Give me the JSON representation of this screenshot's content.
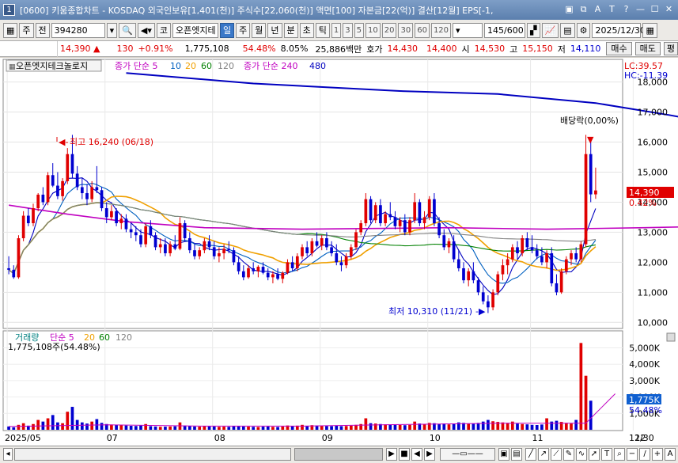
{
  "titlebar": {
    "window_num": "1",
    "text": "[0600] 키움종합차트 - KOSDAQ 외국인보유[1,401(천)] 주식수[22,060(천)] 액면[100] 자본금[22(억)] 결산[12월] EPS[-1,",
    "icons": [
      "window-icon",
      "restore-icon",
      "font-icon",
      "text-icon",
      "help-icon",
      "min-icon",
      "max-icon",
      "close-icon"
    ]
  },
  "toolbar": {
    "main_label": "주",
    "prev_label": "전",
    "code": "394280",
    "stock_name": "오픈엣지테",
    "periods": [
      "일",
      "주",
      "월",
      "년",
      "분",
      "초",
      "틱"
    ],
    "selected_period": "일",
    "intervals": [
      "1",
      "3",
      "5",
      "10",
      "20",
      "30",
      "60",
      "120"
    ],
    "count": "145/600",
    "date": "2025/12/30",
    "market_badge": "코"
  },
  "quote": {
    "price": "14,390",
    "change": "130",
    "change_pct": "+0.91%",
    "volume": "1,775,108",
    "vol_ratio": "54.48%",
    "turnover": "8.05%",
    "amount": "25,886백만",
    "hoga_label": "호가",
    "ask": "14,430",
    "bid": "14,400",
    "open_label": "시",
    "open": "14,530",
    "high_label": "고",
    "high": "15,150",
    "low_label": "저",
    "low": "14,110",
    "buy_label": "매수",
    "sell_label": "매도",
    "eval_label": "평"
  },
  "legend": {
    "stock_name": "오픈엣지테크놀로지",
    "price_ma": "종가 단순 5",
    "ma_periods": [
      "10",
      "20",
      "60",
      "120"
    ],
    "price_ma2": "종가 단순 240",
    "ma2_periods": [
      "480"
    ],
    "volume_title": "거래량",
    "volume_ma": "단순 5",
    "volume_ma_periods": [
      "20",
      "60",
      "120"
    ],
    "volume_value": "1,775,108주(54.48%)"
  },
  "annotations": {
    "high": "최고 16,240 (06/18)",
    "low": "최저 10,310 (11/21)",
    "dividend": "배당락(0,00%)",
    "lc": "LC:39.57",
    "hc": "HC:-11.39",
    "current_price_tag": "14,390",
    "current_pct_tag": "0.42%",
    "vol_tag": "1,775K",
    "vol_pct_tag": "54.48%"
  },
  "colors": {
    "up": "#e00000",
    "down": "#0000d0",
    "ma5": "#0000c0",
    "ma10": "#0060c0",
    "ma20": "#f0a000",
    "ma60": "#008000",
    "ma120": "#808080",
    "ma240": "#c000c0",
    "ma480": "#0000c0"
  },
  "chart_data": {
    "type": "candlestick",
    "price_axis_ticks": [
      "18,000",
      "17,000",
      "16,000",
      "15,000",
      "14,000",
      "13,000",
      "12,000",
      "11,000",
      "10,000"
    ],
    "price_axis_values": [
      18000,
      17000,
      16000,
      15000,
      14000,
      13000,
      12000,
      11000,
      10000
    ],
    "volume_axis_ticks": [
      "5,000K",
      "4,000K",
      "3,000K",
      "2,000K",
      "1,000K"
    ],
    "volume_axis_values": [
      5000,
      4000,
      3000,
      2000,
      1000
    ],
    "x_labels": [
      "2025/05",
      "07",
      "08",
      "09",
      "10",
      "11",
      "12",
      "12/30"
    ],
    "x_label_days": [
      0,
      20,
      42,
      64,
      86,
      107,
      128,
      145
    ],
    "ylim": [
      9850,
      18700
    ],
    "vol_ylim": [
      0,
      5800
    ],
    "ma240": [
      [
        0,
        13900
      ],
      [
        12,
        13600
      ],
      [
        24,
        13350
      ],
      [
        40,
        13150
      ],
      [
        60,
        13100
      ],
      [
        90,
        13150
      ],
      [
        110,
        13100
      ],
      [
        130,
        13150
      ],
      [
        145,
        13200
      ]
    ],
    "ma480": [
      [
        24,
        18300
      ],
      [
        50,
        17950
      ],
      [
        80,
        17700
      ],
      [
        100,
        17600
      ],
      [
        120,
        17300
      ],
      [
        135,
        16900
      ],
      [
        145,
        16600
      ]
    ],
    "candles": [
      [
        11800,
        12200,
        11600,
        11750
      ],
      [
        11750,
        11900,
        11450,
        11500
      ],
      [
        11500,
        12900,
        11450,
        12800
      ],
      [
        12800,
        13700,
        12700,
        13550
      ],
      [
        13550,
        13800,
        13200,
        13300
      ],
      [
        13300,
        13950,
        13200,
        13800
      ],
      [
        13800,
        14300,
        13700,
        14250
      ],
      [
        14250,
        14500,
        13900,
        14000
      ],
      [
        14000,
        15000,
        13900,
        14900
      ],
      [
        14900,
        15300,
        14500,
        14550
      ],
      [
        14550,
        15000,
        14100,
        14200
      ],
      [
        14200,
        14800,
        14050,
        14700
      ],
      [
        14700,
        15800,
        14600,
        15600
      ],
      [
        15600,
        16240,
        14800,
        14950
      ],
      [
        14950,
        15200,
        14400,
        14500
      ],
      [
        14500,
        14800,
        14100,
        14300
      ],
      [
        14300,
        14600,
        13900,
        14100
      ],
      [
        14100,
        14700,
        14000,
        14500
      ],
      [
        14500,
        15200,
        14300,
        14400
      ],
      [
        14400,
        14500,
        13700,
        13800
      ],
      [
        13800,
        14000,
        13300,
        13500
      ],
      [
        13500,
        13900,
        13400,
        13700
      ],
      [
        13700,
        13800,
        13200,
        13300
      ],
      [
        13300,
        13600,
        13100,
        13450
      ],
      [
        13450,
        13600,
        13000,
        13100
      ],
      [
        13100,
        13300,
        12800,
        13000
      ],
      [
        13000,
        13200,
        12700,
        12900
      ],
      [
        12900,
        13100,
        12500,
        12600
      ],
      [
        12600,
        13300,
        12500,
        13200
      ],
      [
        13200,
        13400,
        12800,
        12900
      ],
      [
        12900,
        13000,
        12400,
        12500
      ],
      [
        12500,
        12800,
        12300,
        12600
      ],
      [
        12600,
        12800,
        12200,
        12300
      ],
      [
        12300,
        12700,
        12200,
        12600
      ],
      [
        12600,
        12900,
        12400,
        12450
      ],
      [
        12450,
        13500,
        12400,
        13300
      ],
      [
        13300,
        13400,
        12700,
        12800
      ],
      [
        12800,
        13000,
        12300,
        12400
      ],
      [
        12400,
        12600,
        12100,
        12200
      ],
      [
        12200,
        12500,
        12100,
        12400
      ],
      [
        12400,
        12800,
        12300,
        12700
      ],
      [
        12700,
        12900,
        12400,
        12500
      ],
      [
        12500,
        12700,
        12100,
        12200
      ],
      [
        12200,
        12500,
        12000,
        12300
      ],
      [
        12300,
        12600,
        12100,
        12450
      ],
      [
        12450,
        12700,
        12300,
        12400
      ],
      [
        12400,
        12500,
        11900,
        12000
      ],
      [
        12000,
        12200,
        11600,
        11700
      ],
      [
        11700,
        11900,
        11400,
        11500
      ],
      [
        11500,
        11900,
        11450,
        11800
      ],
      [
        11800,
        12000,
        11600,
        11700
      ],
      [
        11700,
        11900,
        11500,
        11850
      ],
      [
        11850,
        12000,
        11600,
        11650
      ],
      [
        11650,
        11800,
        11400,
        11500
      ],
      [
        11500,
        11700,
        11300,
        11600
      ],
      [
        11600,
        11800,
        11400,
        11450
      ],
      [
        11450,
        11700,
        11300,
        11650
      ],
      [
        11650,
        12100,
        11600,
        12000
      ],
      [
        12000,
        12200,
        11700,
        11800
      ],
      [
        11800,
        12300,
        11700,
        12200
      ],
      [
        12200,
        12600,
        12100,
        12500
      ],
      [
        12500,
        12700,
        12200,
        12300
      ],
      [
        12300,
        12800,
        12200,
        12700
      ],
      [
        12700,
        13000,
        12500,
        12550
      ],
      [
        12550,
        12900,
        12400,
        12800
      ],
      [
        12800,
        13000,
        12400,
        12500
      ],
      [
        12500,
        12700,
        12200,
        12300
      ],
      [
        12300,
        12600,
        11900,
        12000
      ],
      [
        12000,
        12200,
        11700,
        11900
      ],
      [
        11900,
        12300,
        11800,
        12200
      ],
      [
        12200,
        12600,
        12100,
        12500
      ],
      [
        12500,
        13100,
        12400,
        13000
      ],
      [
        13000,
        13400,
        12900,
        13300
      ],
      [
        13300,
        14300,
        13200,
        14100
      ],
      [
        14100,
        14200,
        13300,
        13400
      ],
      [
        13400,
        14000,
        13300,
        13900
      ],
      [
        13900,
        14100,
        13200,
        13300
      ],
      [
        13300,
        13700,
        13200,
        13600
      ],
      [
        13600,
        14000,
        13400,
        13500
      ],
      [
        13500,
        13700,
        13100,
        13200
      ],
      [
        13200,
        13500,
        13000,
        13400
      ],
      [
        13400,
        13600,
        12900,
        13000
      ],
      [
        13000,
        13500,
        12900,
        13400
      ],
      [
        13400,
        14300,
        13300,
        14000
      ],
      [
        14000,
        14100,
        13200,
        13300
      ],
      [
        13300,
        13700,
        13100,
        13500
      ],
      [
        13500,
        14200,
        13400,
        14100
      ],
      [
        14100,
        14300,
        13200,
        13300
      ],
      [
        13300,
        13500,
        12800,
        12900
      ],
      [
        12900,
        13100,
        12400,
        12500
      ],
      [
        12500,
        12800,
        12300,
        12700
      ],
      [
        12700,
        12900,
        12000,
        12100
      ],
      [
        12100,
        12400,
        11700,
        11800
      ],
      [
        11800,
        12000,
        11300,
        11400
      ],
      [
        11400,
        11800,
        11200,
        11700
      ],
      [
        11700,
        12000,
        11300,
        11400
      ],
      [
        11400,
        11500,
        10900,
        11000
      ],
      [
        11000,
        11200,
        10600,
        10700
      ],
      [
        10700,
        10900,
        10310,
        10500
      ],
      [
        10500,
        11100,
        10400,
        11000
      ],
      [
        11000,
        11700,
        10900,
        11600
      ],
      [
        11600,
        12100,
        11400,
        11900
      ],
      [
        11900,
        12300,
        11600,
        12100
      ],
      [
        12100,
        12600,
        12000,
        12500
      ],
      [
        12500,
        12700,
        12100,
        12300
      ],
      [
        12300,
        12900,
        12200,
        12800
      ],
      [
        12800,
        13000,
        12400,
        12500
      ],
      [
        12500,
        12900,
        12300,
        12400
      ],
      [
        12400,
        12600,
        12100,
        12200
      ],
      [
        12200,
        12500,
        11900,
        12000
      ],
      [
        12000,
        12400,
        11800,
        12300
      ],
      [
        12300,
        12500,
        11200,
        11300
      ],
      [
        11300,
        11600,
        10900,
        11000
      ],
      [
        11000,
        11800,
        10950,
        11700
      ],
      [
        11700,
        12200,
        11600,
        12100
      ],
      [
        12100,
        12400,
        11900,
        12300
      ],
      [
        12300,
        12500,
        12000,
        12100
      ],
      [
        12100,
        12700,
        12000,
        12600
      ],
      [
        12600,
        16240,
        12500,
        15600
      ],
      [
        15600,
        16100,
        14000,
        14260
      ],
      [
        14260,
        15150,
        14110,
        14390
      ]
    ],
    "volumes": [
      200,
      150,
      300,
      400,
      250,
      350,
      600,
      500,
      700,
      900,
      450,
      400,
      1100,
      1400,
      600,
      450,
      380,
      500,
      650,
      420,
      350,
      320,
      300,
      280,
      260,
      240,
      230,
      260,
      350,
      220,
      200,
      180,
      190,
      200,
      210,
      450,
      260,
      230,
      200,
      190,
      220,
      210,
      200,
      180,
      190,
      180,
      220,
      240,
      200,
      190,
      180,
      170,
      190,
      200,
      180,
      170,
      200,
      260,
      230,
      250,
      300,
      240,
      280,
      260,
      250,
      230,
      220,
      250,
      220,
      230,
      250,
      300,
      350,
      700,
      400,
      380,
      350,
      330,
      320,
      300,
      290,
      280,
      300,
      500,
      380,
      330,
      420,
      400,
      350,
      380,
      330,
      360,
      450,
      420,
      390,
      380,
      420,
      500,
      600,
      520,
      480,
      450,
      420,
      500,
      380,
      350,
      330,
      300,
      290,
      320,
      700,
      500,
      550,
      480,
      420,
      380,
      600,
      5300,
      3300,
      1775
    ],
    "vol_ma": [
      [
        0,
        200
      ],
      [
        20,
        300
      ],
      [
        40,
        220
      ],
      [
        60,
        220
      ],
      [
        80,
        320
      ],
      [
        100,
        400
      ],
      [
        118,
        400
      ],
      [
        122,
        1600
      ],
      [
        124,
        2200
      ]
    ]
  }
}
